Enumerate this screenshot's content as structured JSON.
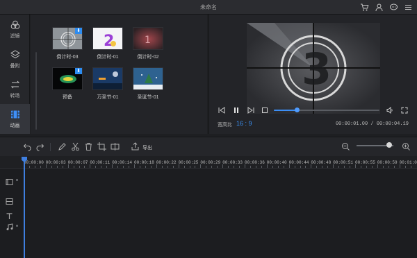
{
  "window": {
    "title": "未命名"
  },
  "sidebar": {
    "items": [
      {
        "label": "滤镜",
        "icon": "filter-icon"
      },
      {
        "label": "叠附",
        "icon": "overlay-icon"
      },
      {
        "label": "转场",
        "icon": "transition-icon"
      },
      {
        "label": "动画",
        "icon": "animation-icon",
        "active": true
      }
    ]
  },
  "library": {
    "items": [
      {
        "label": "倒计时-03",
        "downloaded": true
      },
      {
        "label": "倒计时-01",
        "downloaded": false
      },
      {
        "label": "倒计时-02",
        "downloaded": false
      },
      {
        "label": "预备",
        "downloaded": true
      },
      {
        "label": "万圣节-01",
        "downloaded": false
      },
      {
        "label": "圣诞节-01",
        "downloaded": false
      }
    ],
    "download_glyph": "⬇"
  },
  "preview": {
    "countdown_digit": "3",
    "ratio_label": "宽高比",
    "ratio_value": "16 : 9",
    "timecode": "00:00:01.00 / 00:00:04.19",
    "progress": 0.22
  },
  "toolbar": {
    "export_label": "导出",
    "zoom_level": 0.88
  },
  "timeline": {
    "ticks": [
      "00:00:00",
      "00:00:03",
      "00:00:07",
      "00:00:11",
      "00:00:14",
      "00:00:18",
      "00:00:22",
      "00:00:25",
      "00:00:29",
      "00:00:33",
      "00:00:36",
      "00:00:40",
      "00:00:44",
      "00:00:48",
      "00:00:51",
      "00:00:55",
      "00:00:59",
      "00:01:02"
    ]
  },
  "colors": {
    "accent": "#3c8ef5",
    "background": "#1e1f22",
    "panel": "#232428"
  }
}
